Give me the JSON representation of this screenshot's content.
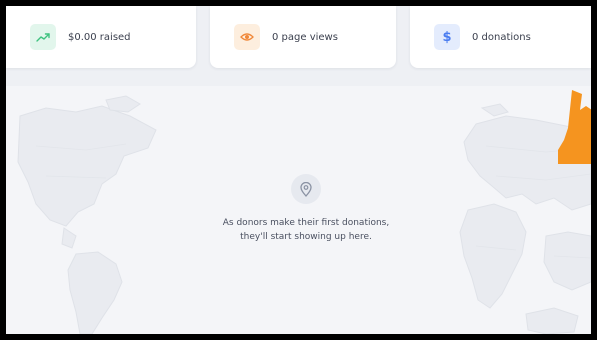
{
  "stats": {
    "raised": {
      "label": "$0.00 raised",
      "icon": "trending-up-icon",
      "color": "#3ec27f",
      "bg": "#e2f6ec"
    },
    "views": {
      "label": "0 page views",
      "icon": "eye-icon",
      "color": "#f0883a",
      "bg": "#fdeede"
    },
    "donations": {
      "label": "0 donations",
      "icon": "dollar-icon",
      "glyph": "$",
      "color": "#4a7cf0",
      "bg": "#e4ecfd"
    }
  },
  "empty_state": {
    "icon": "map-pin-icon",
    "line1": "As donors make their first donations,",
    "line2": "they'll start showing up here."
  },
  "colors": {
    "map_fill": "#e9ebf0",
    "map_stroke": "#dfe2e8",
    "cursor": "#f5941f"
  }
}
